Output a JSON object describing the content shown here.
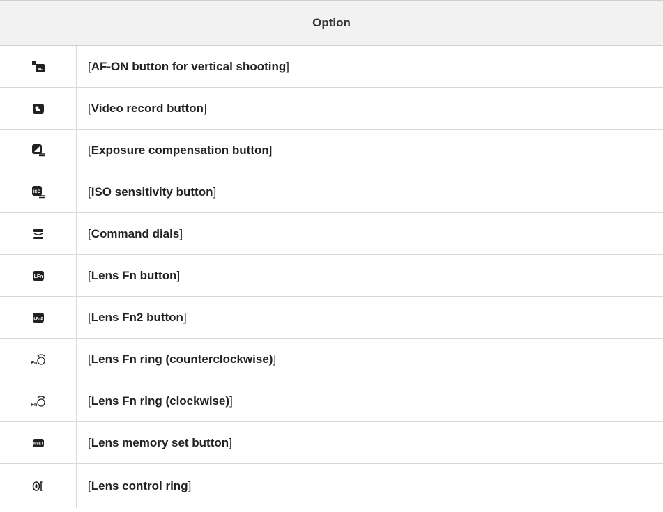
{
  "table": {
    "header": "Option",
    "rows": [
      {
        "icon": "af-on-vertical-icon",
        "label": "AF-ON button for vertical shooting"
      },
      {
        "icon": "video-record-icon",
        "label": "Video record button"
      },
      {
        "icon": "exposure-compensation-icon",
        "label": "Exposure compensation button"
      },
      {
        "icon": "iso-sensitivity-icon",
        "label": "ISO sensitivity button"
      },
      {
        "icon": "command-dials-icon",
        "label": "Command dials"
      },
      {
        "icon": "lens-fn-icon",
        "label": "Lens Fn button"
      },
      {
        "icon": "lens-fn2-icon",
        "label": "Lens Fn2 button"
      },
      {
        "icon": "fn-ring-ccw-icon",
        "label": "Lens Fn ring (counterclockwise)"
      },
      {
        "icon": "fn-ring-cw-icon",
        "label": "Lens Fn ring (clockwise)"
      },
      {
        "icon": "lens-memory-set-icon",
        "label": "Lens memory set button"
      },
      {
        "icon": "lens-control-ring-icon",
        "label": "Lens control ring"
      }
    ]
  }
}
